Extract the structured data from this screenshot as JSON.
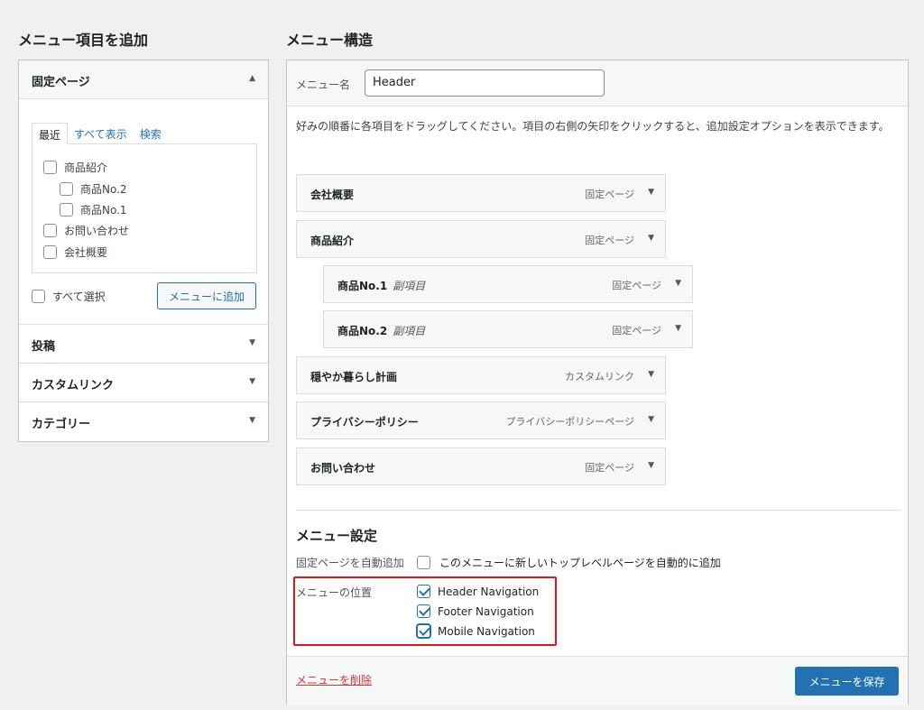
{
  "left_title": "メニュー項目を追加",
  "right_title": "メニュー構造",
  "add_panel": {
    "pages": {
      "header": "固定ページ",
      "tabs": [
        "最近",
        "すべて表示",
        "検索"
      ],
      "items": [
        {
          "label": "商品紹介"
        },
        {
          "label": "商品No.2"
        },
        {
          "label": "商品No.1"
        },
        {
          "label": "お問い合わせ"
        },
        {
          "label": "会社概要"
        }
      ],
      "select_all": "すべて選択",
      "add_button": "メニューに追加"
    },
    "collapsed_sections": [
      "投稿",
      "カスタムリンク",
      "カテゴリー"
    ]
  },
  "menu": {
    "name_label": "メニュー名",
    "name_value": "Header",
    "instructions": "好みの順番に各項目をドラッグしてください。項目の右側の矢印をクリックすると、追加設定オプションを表示できます。",
    "items": [
      {
        "title": "会社概要",
        "sub": "",
        "type": "固定ページ"
      },
      {
        "title": "商品紹介",
        "sub": "",
        "type": "固定ページ"
      },
      {
        "title": "商品No.1",
        "sub": "副項目",
        "type": "固定ページ"
      },
      {
        "title": "商品No.2",
        "sub": "副項目",
        "type": "固定ページ"
      },
      {
        "title": "穏やか暮らし計画",
        "sub": "",
        "type": "カスタムリンク"
      },
      {
        "title": "プライバシーポリシー",
        "sub": "",
        "type": "プライバシーポリシーページ"
      },
      {
        "title": "お問い合わせ",
        "sub": "",
        "type": "固定ページ"
      }
    ]
  },
  "settings": {
    "title": "メニュー設定",
    "auto_add_label": "固定ページを自動追加",
    "auto_add_text": "このメニューに新しいトップレベルページを自動的に追加",
    "location_label": "メニューの位置",
    "locations": [
      {
        "label": "Header Navigation",
        "checked": true
      },
      {
        "label": "Footer Navigation",
        "checked": true
      },
      {
        "label": "Mobile Navigation",
        "checked": true
      }
    ]
  },
  "footer": {
    "delete_link": "メニューを削除",
    "save_button": "メニューを保存"
  },
  "colors": {
    "accent": "#2271b1",
    "danger": "#d63638",
    "highlight": "#e0161a"
  }
}
